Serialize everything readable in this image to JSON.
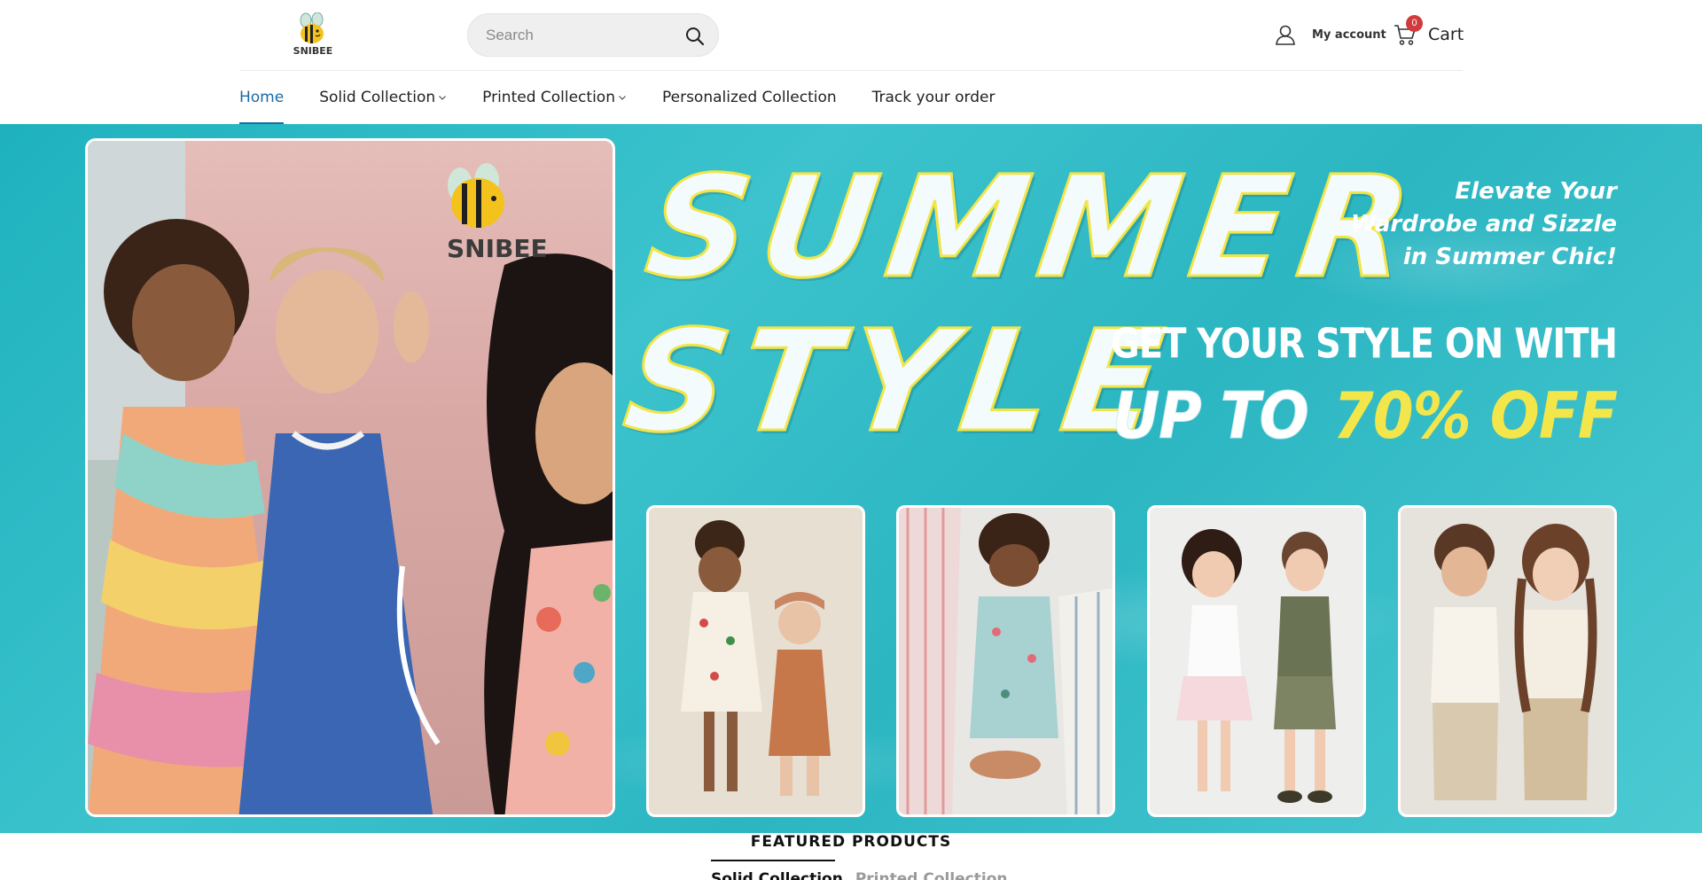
{
  "header": {
    "logo_text": "SNIBEE",
    "search_placeholder": "Search",
    "account_label": "My account",
    "cart_label": "Cart",
    "cart_count": "0"
  },
  "nav": {
    "items": [
      {
        "label": "Home",
        "active": true
      },
      {
        "label": "Solid Collection",
        "dropdown": true
      },
      {
        "label": "Printed Collection",
        "dropdown": true
      },
      {
        "label": "Personalized Collection"
      },
      {
        "label": "Track your order"
      }
    ]
  },
  "hero": {
    "brand": "SNIBEE",
    "title_line1": "SUMMER",
    "title_line2": "STYLE",
    "tagline_line1": "Elevate Your",
    "tagline_line2": "Wardrobe and Sizzle",
    "tagline_line3": "in Summer Chic!",
    "promo_line1": "GET YOUR STYLE ON WITH",
    "promo_upto": "UP TO",
    "promo_off": "70% OFF"
  },
  "featured": {
    "title": "FEATURED PRODUCTS",
    "tabs": [
      "Solid Collection",
      "Printed Collection"
    ]
  },
  "colors": {
    "accent": "#1b6aa5",
    "badge": "#d13b3b",
    "hero_bg": "#2bb6c2",
    "promo_yellow": "#f3e64a"
  }
}
